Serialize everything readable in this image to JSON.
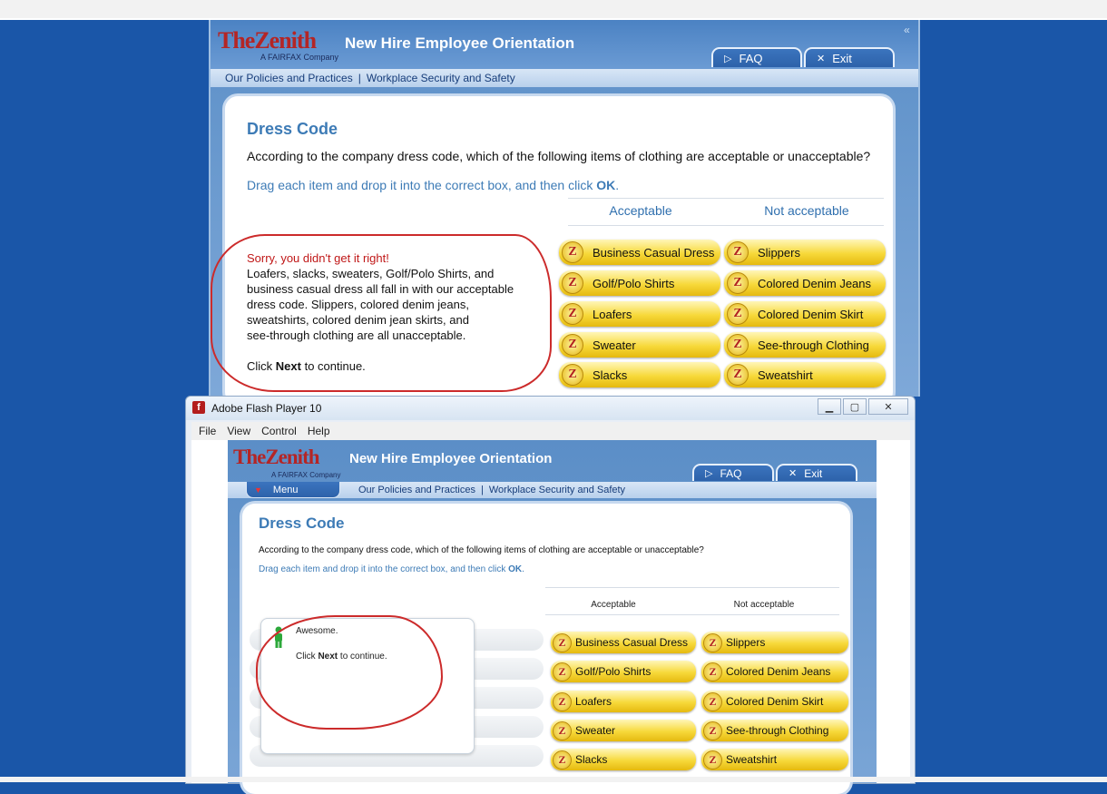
{
  "top_app": {
    "logo_text": "TheZenith",
    "logo_sub": "A FAIRFAX Company",
    "title": "New Hire Employee Orientation",
    "faq_label": "FAQ",
    "exit_label": "Exit",
    "breadcrumb": [
      "Our Policies and Practices",
      "Workplace Security and Safety"
    ],
    "heading": "Dress Code",
    "question": "According to the company dress code, which of the following items of clothing are acceptable or unacceptable?",
    "instruction_pre": "Drag each item and drop it into the correct box, and then click ",
    "instruction_ok": "OK",
    "instruction_post": ".",
    "col_acceptable": "Acceptable",
    "col_not_acceptable": "Not acceptable",
    "acceptable_items": [
      "Business Casual Dress",
      "Golf/Polo Shirts",
      "Loafers",
      "Sweater",
      "Slacks"
    ],
    "not_acceptable_items": [
      "Slippers",
      "Colored Denim Jeans",
      "Colored Denim Skirt",
      "See-through Clothing",
      "Sweatshirt"
    ],
    "feedback": {
      "error_line": "Sorry, you didn't get it right!",
      "lines": [
        "Loafers, slacks, sweaters, Golf/Polo Shirts, and",
        "business casual dress all fall in with our acceptable",
        "dress code. Slippers, colored denim jeans,",
        "sweatshirts, colored denim jean skirts, and",
        "see-through clothing are all unacceptable."
      ],
      "click_pre": "Click ",
      "click_next": "Next",
      "click_post": " to continue."
    }
  },
  "flash_window": {
    "title": "Adobe Flash Player 10",
    "menu": [
      "File",
      "View",
      "Control",
      "Help"
    ],
    "app": {
      "logo_text": "TheZenith",
      "logo_sub": "A FAIRFAX Company",
      "title": "New Hire Employee Orientation",
      "faq_label": "FAQ",
      "exit_label": "Exit",
      "menu_label": "Menu",
      "breadcrumb": [
        "Our Policies and Practices",
        "Workplace Security and Safety"
      ],
      "heading": "Dress Code",
      "question": "According to the company dress code, which of the following items of clothing are acceptable or unacceptable?",
      "instruction_pre": "Drag each item and drop it into the correct box, and then click ",
      "instruction_ok": "OK",
      "instruction_post": ".",
      "col_acceptable": "Acceptable",
      "col_not_acceptable": "Not acceptable",
      "acceptable_items": [
        "Business Casual Dress",
        "Golf/Polo Shirts",
        "Loafers",
        "Sweater",
        "Slacks"
      ],
      "not_acceptable_items": [
        "Slippers",
        "Colored Denim Jeans",
        "Colored Denim Skirt",
        "See-through Clothing",
        "Sweatshirt"
      ],
      "feedback": {
        "line1": "Awesome.",
        "click_pre": "Click ",
        "click_next": "Next",
        "click_post": " to continue."
      }
    }
  },
  "colors": {
    "desktop": "#1a56a8",
    "brand_red": "#b42525",
    "heading_blue": "#3d7bb6",
    "pill_yellow": "#f7d93a",
    "annotation_red": "#cc2b2b"
  },
  "icons": [
    "flash-icon",
    "z-logo-icon",
    "play-triangle-icon",
    "close-x-icon",
    "person-icon"
  ]
}
